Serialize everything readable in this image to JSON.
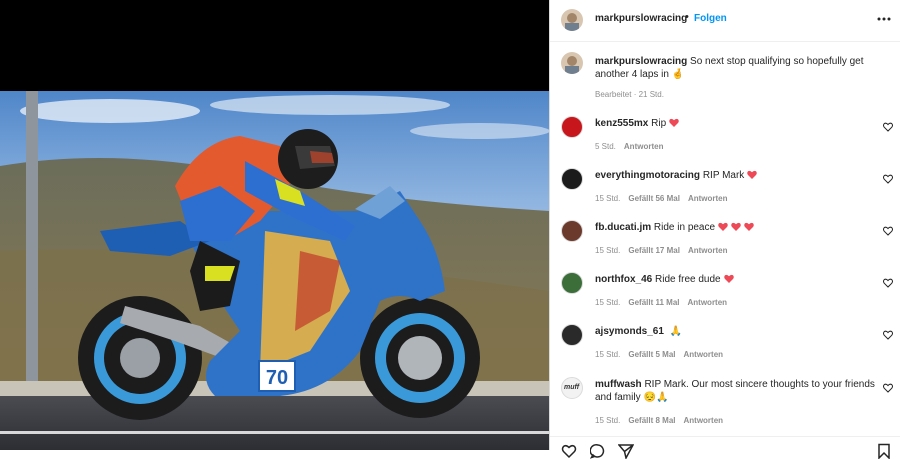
{
  "post": {
    "username": "markpurslowracing",
    "separator": "•",
    "follow_label": "Folgen",
    "caption": {
      "username": "markpurslowracing",
      "text": "So next stop qualifying so hopefully get another 4 laps in",
      "emoji": "🤞",
      "meta": "Bearbeitet · 21 Std."
    },
    "bike_number": "70"
  },
  "comments": [
    {
      "username": "kenz555mx",
      "text": "Rip",
      "hearts": 1,
      "emoji": "",
      "time": "5 Std.",
      "likes": "",
      "reply": "Antworten",
      "avatar_color": "#c8161d"
    },
    {
      "username": "everythingmotoracing",
      "text": "RIP Mark",
      "hearts": 1,
      "emoji": "",
      "time": "15 Std.",
      "likes": "Gefällt 56 Mal",
      "reply": "Antworten",
      "avatar_color": "#1b1b1b"
    },
    {
      "username": "fb.ducati.jm",
      "text": "Ride in peace",
      "hearts": 3,
      "emoji": "",
      "time": "15 Std.",
      "likes": "Gefällt 17 Mal",
      "reply": "Antworten",
      "avatar_color": "#6b3a2c"
    },
    {
      "username": "northfox_46",
      "text": "Ride free dude",
      "hearts": 1,
      "emoji": "",
      "time": "15 Std.",
      "likes": "Gefällt 11 Mal",
      "reply": "Antworten",
      "avatar_color": "#3c6e3a"
    },
    {
      "username": "ajsymonds_61",
      "text": "",
      "hearts": 0,
      "emoji": "🙏",
      "time": "15 Std.",
      "likes": "Gefällt 5 Mal",
      "reply": "Antworten",
      "avatar_color": "#2a2a2a"
    },
    {
      "username": "muffwash",
      "text": "RIP Mark. Our most sincere thoughts to your friends and family",
      "hearts": 0,
      "emoji": "😔🙏",
      "time": "15 Std.",
      "likes": "Gefällt 8 Mal",
      "reply": "Antworten",
      "avatar_color": "#f2f2f2",
      "avatar_text": "muff"
    }
  ],
  "icons": {
    "more": "more-icon",
    "like": "heart-icon",
    "comment": "comment-icon",
    "share": "share-icon",
    "save": "bookmark-icon"
  },
  "colors": {
    "accent": "#0095f6",
    "heart": "#ed4956",
    "text": "#262626",
    "muted": "#8e8e8e"
  }
}
